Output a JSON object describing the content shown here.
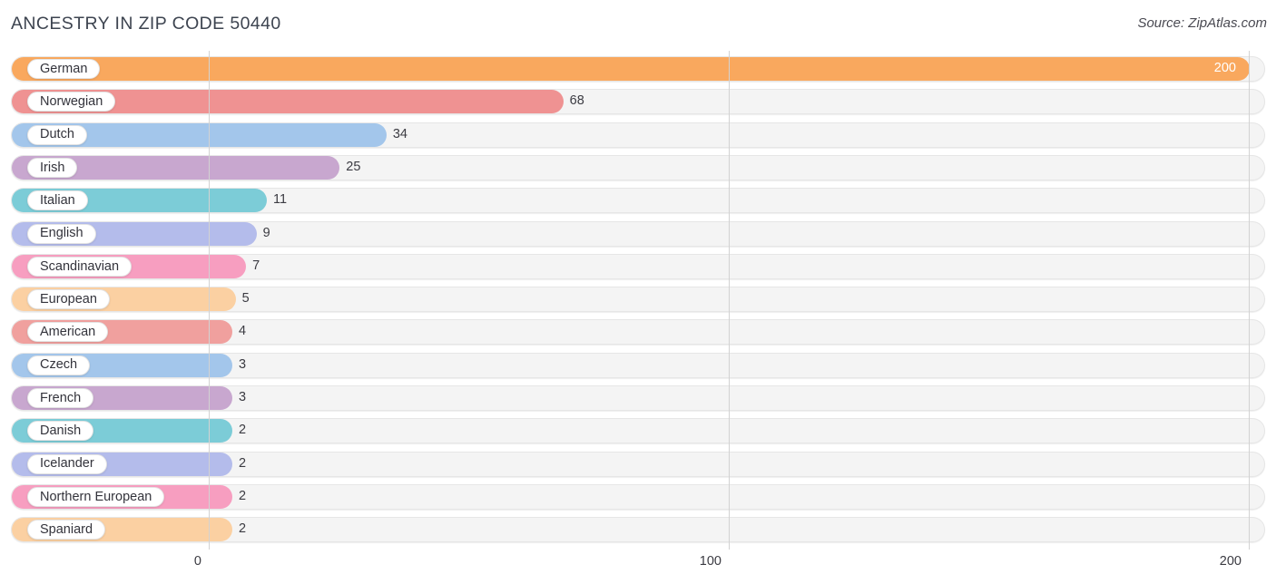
{
  "header": {
    "title": "ANCESTRY IN ZIP CODE 50440",
    "source": "Source: ZipAtlas.com"
  },
  "chart_data": {
    "type": "bar",
    "orientation": "horizontal",
    "title": "ANCESTRY IN ZIP CODE 50440",
    "xlabel": "",
    "ylabel": "",
    "xlim": [
      0,
      200
    ],
    "grid": true,
    "legend": false,
    "xticks": [
      "0",
      "100",
      "200"
    ],
    "xtick_values": [
      0,
      100,
      200
    ],
    "categories": [
      "German",
      "Norwegian",
      "Dutch",
      "Irish",
      "Italian",
      "English",
      "Scandinavian",
      "European",
      "American",
      "Czech",
      "French",
      "Danish",
      "Icelander",
      "Northern European",
      "Spaniard"
    ],
    "values": [
      200,
      68,
      34,
      25,
      11,
      9,
      7,
      5,
      4,
      3,
      3,
      2,
      2,
      2,
      2
    ],
    "value_labels": [
      "200",
      "68",
      "34",
      "25",
      "11",
      "9",
      "7",
      "5",
      "4",
      "3",
      "3",
      "2",
      "2",
      "2",
      "2"
    ],
    "colors": [
      "#f9a85e",
      "#ef9292",
      "#a3c6eb",
      "#c8a7cf",
      "#7cccd7",
      "#b4bceb",
      "#f79ec0",
      "#fbd0a2",
      "#f0a09e",
      "#a3c6eb",
      "#c8a7cf",
      "#7cccd7",
      "#b4bceb",
      "#f79ec0",
      "#fbd0a2"
    ],
    "bars": [
      {
        "label": "German",
        "value": 200,
        "value_label": "200",
        "color": "#f9a85e",
        "label_inside": true
      },
      {
        "label": "Norwegian",
        "value": 68,
        "value_label": "68",
        "color": "#ef9292",
        "label_inside": false
      },
      {
        "label": "Dutch",
        "value": 34,
        "value_label": "34",
        "color": "#a3c6eb",
        "label_inside": false
      },
      {
        "label": "Irish",
        "value": 25,
        "value_label": "25",
        "color": "#c8a7cf",
        "label_inside": false
      },
      {
        "label": "Italian",
        "value": 11,
        "value_label": "11",
        "color": "#7cccd7",
        "label_inside": false
      },
      {
        "label": "English",
        "value": 9,
        "value_label": "9",
        "color": "#b4bceb",
        "label_inside": false
      },
      {
        "label": "Scandinavian",
        "value": 7,
        "value_label": "7",
        "color": "#f79ec0",
        "label_inside": false
      },
      {
        "label": "European",
        "value": 5,
        "value_label": "5",
        "color": "#fbd0a2",
        "label_inside": false
      },
      {
        "label": "American",
        "value": 4,
        "value_label": "4",
        "color": "#f0a09e",
        "label_inside": false
      },
      {
        "label": "Czech",
        "value": 3,
        "value_label": "3",
        "color": "#a3c6eb",
        "label_inside": false
      },
      {
        "label": "French",
        "value": 3,
        "value_label": "3",
        "color": "#c8a7cf",
        "label_inside": false
      },
      {
        "label": "Danish",
        "value": 2,
        "value_label": "2",
        "color": "#7cccd7",
        "label_inside": false
      },
      {
        "label": "Icelander",
        "value": 2,
        "value_label": "2",
        "color": "#b4bceb",
        "label_inside": false
      },
      {
        "label": "Northern European",
        "value": 2,
        "value_label": "2",
        "color": "#f79ec0",
        "label_inside": false
      },
      {
        "label": "Spaniard",
        "value": 2,
        "value_label": "2",
        "color": "#fbd0a2",
        "label_inside": false
      }
    ]
  }
}
